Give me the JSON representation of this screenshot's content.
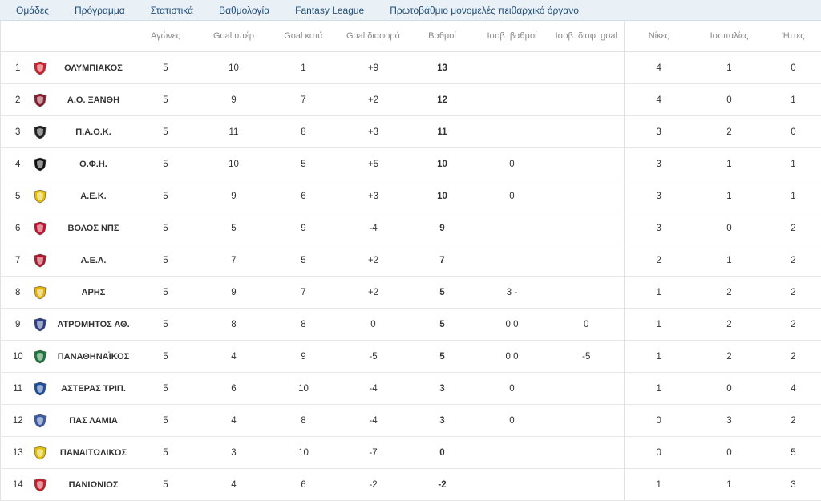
{
  "nav": [
    "Ομάδες",
    "Πρόγραμμα",
    "Στατιστικά",
    "Βαθμολογία",
    "Fantasy League",
    "Πρωτοβάθμιο μονομελές πειθαρχικό όργανο"
  ],
  "headers": {
    "played": "Αγώνες",
    "gf": "Goal υπέρ",
    "ga": "Goal κατά",
    "gd": "Goal διαφορά",
    "pts": "Βαθμοί",
    "tie_pts": "Ισοβ. βαθμοί",
    "tie_gd": "Ισοβ. διαφ. goal",
    "wins": "Νίκες",
    "draws": "Ισοπαλίες",
    "losses": "Ήττες"
  },
  "crest_colors": {
    "olympiakos": "#d0202e",
    "xanthi": "#8a1c2b",
    "paok": "#222222",
    "ofi": "#111111",
    "aek": "#e5c000",
    "volos": "#c8102e",
    "ael": "#b3162b",
    "aris": "#e1b300",
    "atromitos": "#2a3f87",
    "panathinaikos": "#1d7a3a",
    "asteras": "#1e4fa0",
    "lamia": "#3b5ca8",
    "panaitolikos": "#e0c000",
    "panionios": "#c81e2b"
  },
  "rows": [
    {
      "pos": "1",
      "team": "ΟΛΥΜΠΙΑΚΟΣ",
      "crest": "olympiakos",
      "played": "5",
      "gf": "10",
      "ga": "1",
      "gd": "+9",
      "pts": "13",
      "tie_pts": "",
      "tie_gd": "",
      "wins": "4",
      "draws": "1",
      "losses": "0"
    },
    {
      "pos": "2",
      "team": "Α.Ο. ΞΑΝΘΗ",
      "crest": "xanthi",
      "played": "5",
      "gf": "9",
      "ga": "7",
      "gd": "+2",
      "pts": "12",
      "tie_pts": "",
      "tie_gd": "",
      "wins": "4",
      "draws": "0",
      "losses": "1"
    },
    {
      "pos": "3",
      "team": "Π.Α.Ο.Κ.",
      "crest": "paok",
      "played": "5",
      "gf": "11",
      "ga": "8",
      "gd": "+3",
      "pts": "11",
      "tie_pts": "",
      "tie_gd": "",
      "wins": "3",
      "draws": "2",
      "losses": "0"
    },
    {
      "pos": "4",
      "team": "Ο.Φ.Η.",
      "crest": "ofi",
      "played": "5",
      "gf": "10",
      "ga": "5",
      "gd": "+5",
      "pts": "10",
      "tie_pts": "0",
      "tie_gd": "",
      "wins": "3",
      "draws": "1",
      "losses": "1"
    },
    {
      "pos": "5",
      "team": "Α.Ε.Κ.",
      "crest": "aek",
      "played": "5",
      "gf": "9",
      "ga": "6",
      "gd": "+3",
      "pts": "10",
      "tie_pts": "0",
      "tie_gd": "",
      "wins": "3",
      "draws": "1",
      "losses": "1"
    },
    {
      "pos": "6",
      "team": "ΒΟΛΟΣ ΝΠΣ",
      "crest": "volos",
      "played": "5",
      "gf": "5",
      "ga": "9",
      "gd": "-4",
      "pts": "9",
      "tie_pts": "",
      "tie_gd": "",
      "wins": "3",
      "draws": "0",
      "losses": "2"
    },
    {
      "pos": "7",
      "team": "Α.Ε.Λ.",
      "crest": "ael",
      "played": "5",
      "gf": "7",
      "ga": "5",
      "gd": "+2",
      "pts": "7",
      "tie_pts": "",
      "tie_gd": "",
      "wins": "2",
      "draws": "1",
      "losses": "2"
    },
    {
      "pos": "8",
      "team": "ΑΡΗΣ",
      "crest": "aris",
      "played": "5",
      "gf": "9",
      "ga": "7",
      "gd": "+2",
      "pts": "5",
      "tie_pts": "3 -",
      "tie_gd": "",
      "wins": "1",
      "draws": "2",
      "losses": "2"
    },
    {
      "pos": "9",
      "team": "ΑΤΡΟΜΗΤΟΣ ΑΘ.",
      "crest": "atromitos",
      "played": "5",
      "gf": "8",
      "ga": "8",
      "gd": "0",
      "pts": "5",
      "tie_pts": "0 0",
      "tie_gd": "0",
      "wins": "1",
      "draws": "2",
      "losses": "2"
    },
    {
      "pos": "10",
      "team": "ΠΑΝΑΘΗΝΑΪΚΟΣ",
      "crest": "panathinaikos",
      "played": "5",
      "gf": "4",
      "ga": "9",
      "gd": "-5",
      "pts": "5",
      "tie_pts": "0 0",
      "tie_gd": "-5",
      "wins": "1",
      "draws": "2",
      "losses": "2"
    },
    {
      "pos": "11",
      "team": "ΑΣΤΕΡΑΣ ΤΡΙΠ.",
      "crest": "asteras",
      "played": "5",
      "gf": "6",
      "ga": "10",
      "gd": "-4",
      "pts": "3",
      "tie_pts": "0",
      "tie_gd": "",
      "wins": "1",
      "draws": "0",
      "losses": "4"
    },
    {
      "pos": "12",
      "team": "ΠΑΣ ΛΑΜΙΑ",
      "crest": "lamia",
      "played": "5",
      "gf": "4",
      "ga": "8",
      "gd": "-4",
      "pts": "3",
      "tie_pts": "0",
      "tie_gd": "",
      "wins": "0",
      "draws": "3",
      "losses": "2"
    },
    {
      "pos": "13",
      "team": "ΠΑΝΑΙΤΩΛΙΚΟΣ",
      "crest": "panaitolikos",
      "played": "5",
      "gf": "3",
      "ga": "10",
      "gd": "-7",
      "pts": "0",
      "tie_pts": "",
      "tie_gd": "",
      "wins": "0",
      "draws": "0",
      "losses": "5"
    },
    {
      "pos": "14",
      "team": "ΠΑΝΙΩΝΙΟΣ",
      "crest": "panionios",
      "played": "5",
      "gf": "4",
      "ga": "6",
      "gd": "-2",
      "pts": "-2",
      "tie_pts": "",
      "tie_gd": "",
      "wins": "1",
      "draws": "1",
      "losses": "3"
    }
  ]
}
